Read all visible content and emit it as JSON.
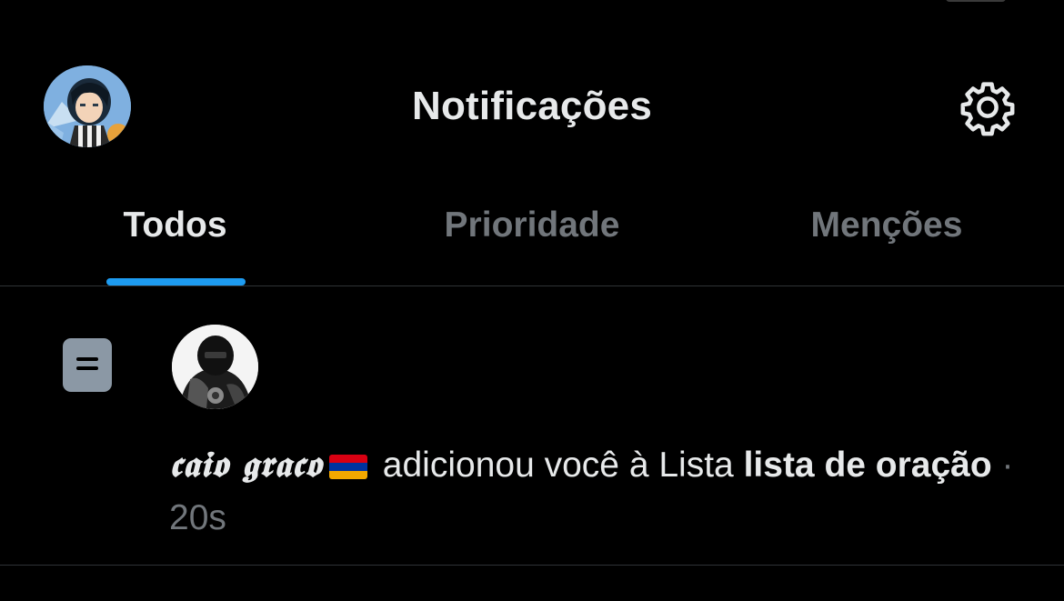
{
  "header": {
    "title": "Notificações",
    "avatar_icon": "profile-avatar-icon",
    "settings_icon": "gear-icon"
  },
  "tabs": [
    {
      "label": "Todos",
      "active": true
    },
    {
      "label": "Prioridade",
      "active": false
    },
    {
      "label": "Menções",
      "active": false
    }
  ],
  "colors": {
    "background": "#000000",
    "text_primary": "#e7e9ea",
    "text_secondary": "#71767b",
    "accent": "#1d9bf0",
    "divider": "#2f3336"
  },
  "notification": {
    "type_icon": "list-icon",
    "sender_name": "𝖈𝖆𝖎𝖔 𝖌𝖗𝖆𝖈𝖔",
    "sender_flag": "armenia-flag-icon",
    "action_text": " adicionou você à Lista ",
    "list_name": "lista de oração",
    "separator": " · ",
    "time": "20s"
  }
}
